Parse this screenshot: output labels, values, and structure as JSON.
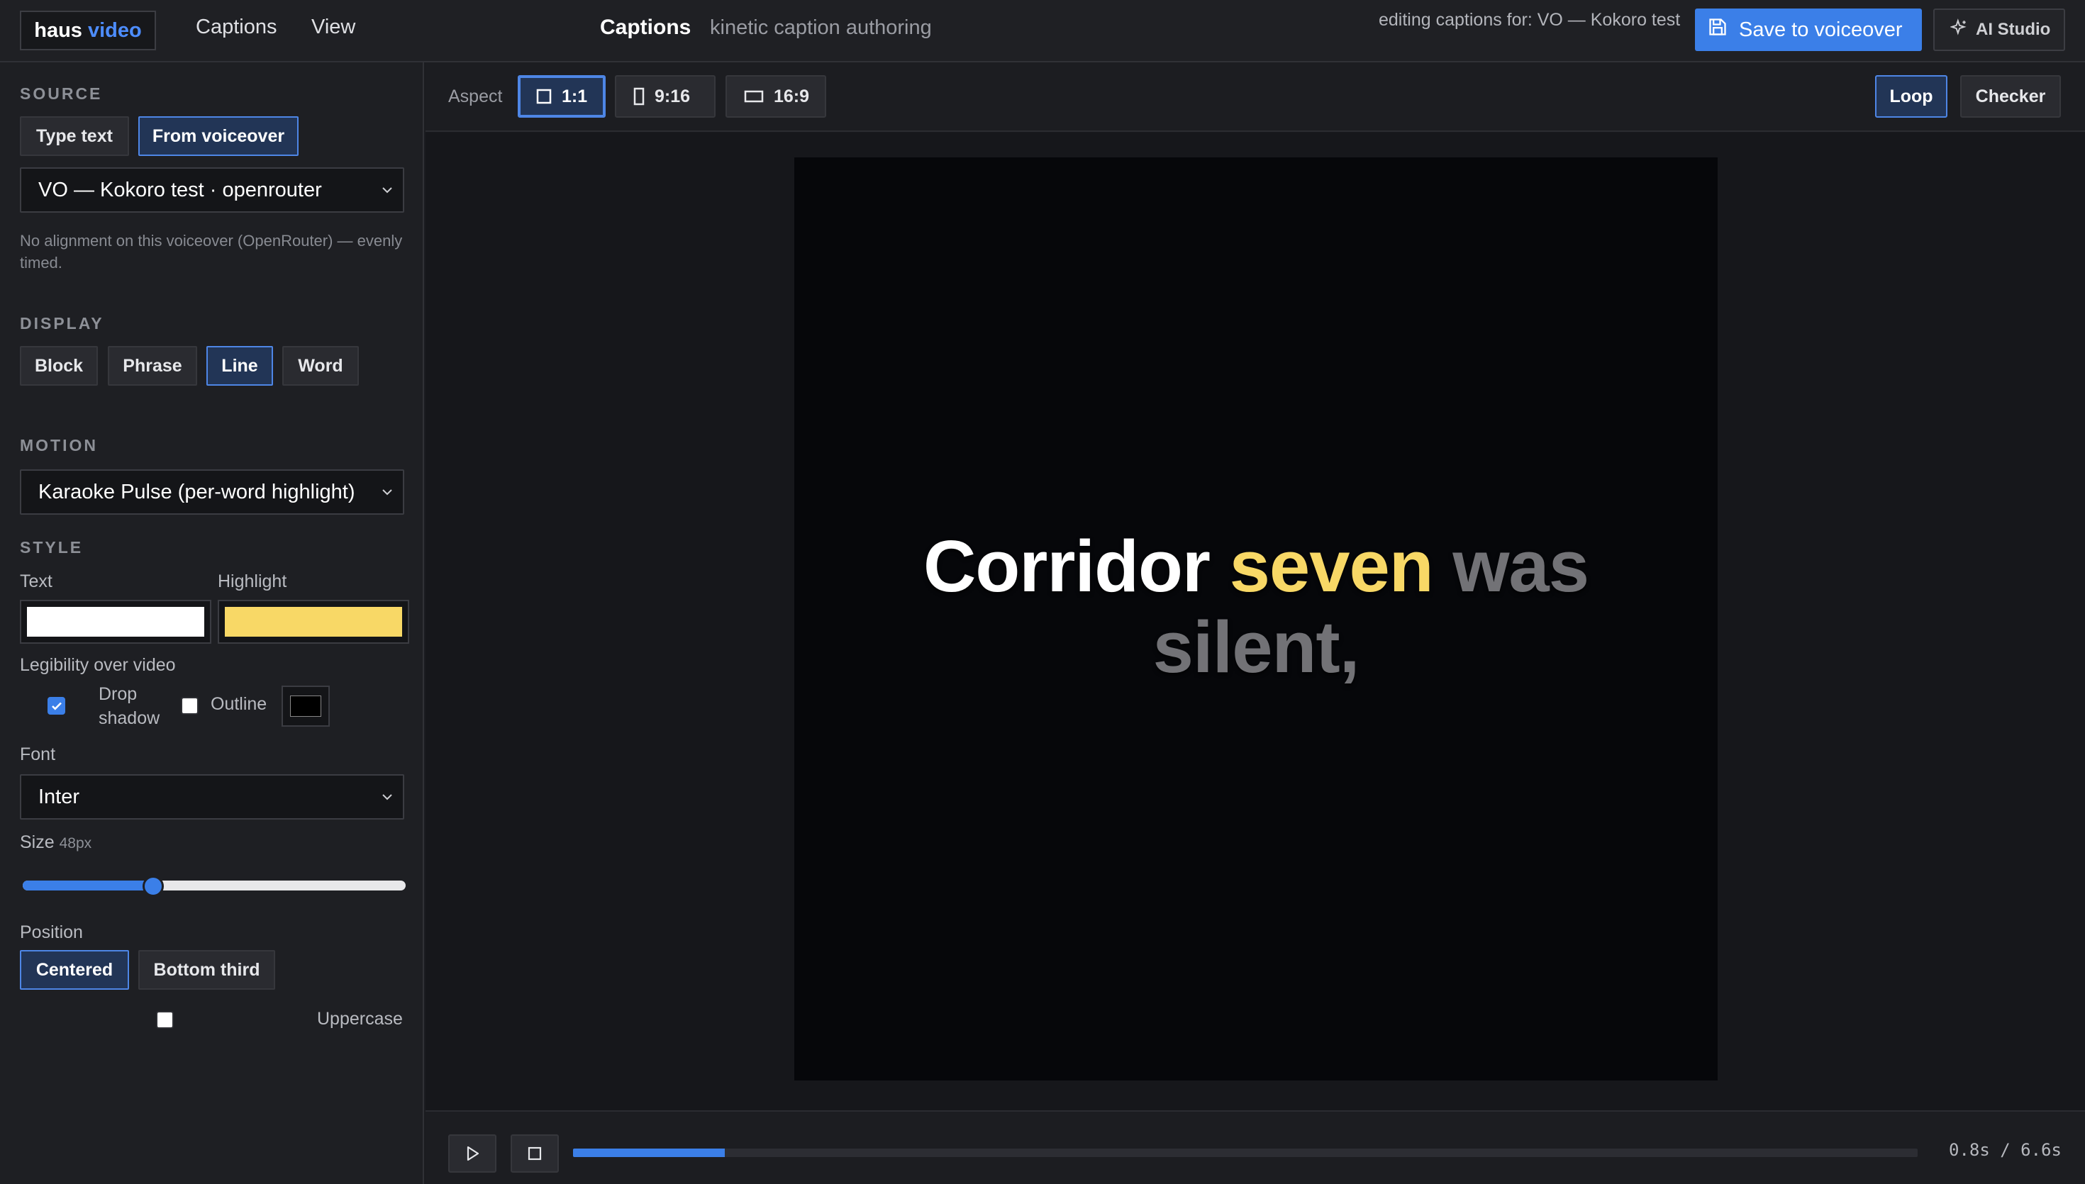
{
  "app": {
    "logo_part1": "haus",
    "logo_part2": "video",
    "menu": [
      "Captions",
      "View"
    ],
    "title": "Captions",
    "subtitle": "kinetic caption authoring",
    "editing_label": "editing captions for: VO — Kokoro test",
    "save_label": "Save to voiceover",
    "ai_label": "AI Studio"
  },
  "source": {
    "heading": "SOURCE",
    "tabs": [
      {
        "label": "Type text",
        "active": false
      },
      {
        "label": "From voiceover",
        "active": true
      }
    ],
    "voiceover_select": "VO — Kokoro test · openrouter",
    "note": "No alignment on this voiceover (OpenRouter) — evenly timed."
  },
  "display": {
    "heading": "DISPLAY",
    "options": [
      {
        "label": "Block",
        "active": false
      },
      {
        "label": "Phrase",
        "active": false
      },
      {
        "label": "Line",
        "active": true
      },
      {
        "label": "Word",
        "active": false
      }
    ]
  },
  "motion": {
    "heading": "MOTION",
    "select": "Karaoke Pulse (per-word highlight)"
  },
  "style": {
    "heading": "STYLE",
    "text_label": "Text",
    "text_color": "#ffffff",
    "highlight_label": "Highlight",
    "highlight_color": "#f8d866",
    "legibility_label": "Legibility over video",
    "drop_shadow_label": "Drop shadow",
    "drop_shadow_checked": true,
    "outline_label": "Outline",
    "outline_checked": false,
    "outline_color": "#000000",
    "font_label": "Font",
    "font_select": "Inter",
    "size_label": "Size",
    "size_value": "48px",
    "size_fraction": 0.34,
    "position_label": "Position",
    "positions": [
      {
        "label": "Centered",
        "active": true
      },
      {
        "label": "Bottom third",
        "active": false
      }
    ],
    "uppercase_label": "Uppercase",
    "uppercase_checked": false
  },
  "preview": {
    "aspect_label": "Aspect",
    "aspects": [
      {
        "label": "1:1",
        "active": true,
        "icon": "square-icon"
      },
      {
        "label": "9:16",
        "active": false,
        "icon": "portrait-icon"
      },
      {
        "label": "16:9",
        "active": false,
        "icon": "landscape-icon"
      }
    ],
    "loop_label": "Loop",
    "loop_active": true,
    "checker_label": "Checker",
    "checker_active": false,
    "caption_words": [
      {
        "text": "Corridor",
        "state": "spoken"
      },
      {
        "text": "seven",
        "state": "active"
      },
      {
        "text": "was",
        "state": "upcoming"
      },
      {
        "text": "silent,",
        "state": "upcoming"
      }
    ],
    "playback_fraction": 0.113,
    "time_readout": "0.8s / 6.6s"
  },
  "colors": {
    "accent": "#3b7fe8",
    "highlight": "#f8d866",
    "upcoming_word": "#727276"
  }
}
